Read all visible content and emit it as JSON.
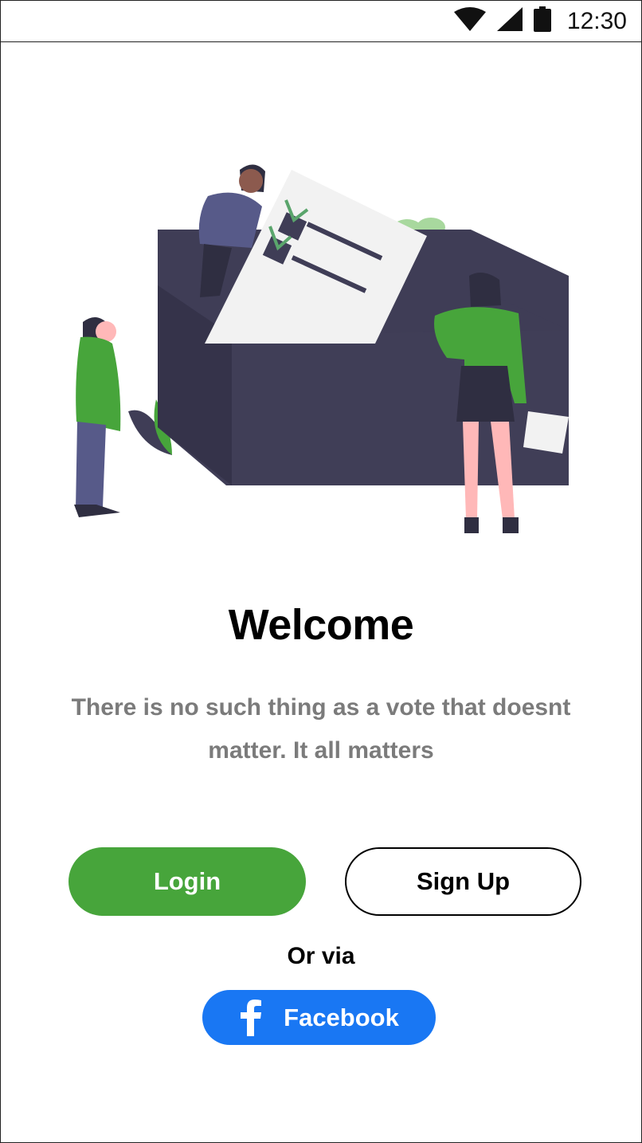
{
  "status_bar": {
    "time": "12:30",
    "icons": [
      "wifi-icon",
      "cellular-signal-icon",
      "battery-icon"
    ]
  },
  "illustration": {
    "name": "voting-illustration",
    "colors": {
      "ballot_box": "#3f3d56",
      "shirt_green": "#47a53b",
      "paper": "#f2f2f2",
      "check": "#5aa56c",
      "skin": "#ffb8b8",
      "jacket": "#575a89"
    }
  },
  "welcome": {
    "title": "Welcome",
    "subtitle": "There is no such thing as a vote that doesnt matter. It all matters"
  },
  "actions": {
    "login_label": "Login",
    "signup_label": "Sign Up",
    "or_via": "Or via",
    "facebook_label": "Facebook",
    "facebook_icon": "facebook-icon"
  },
  "colors": {
    "accent_green": "#47a53b",
    "facebook_blue": "#1977f3",
    "subtitle_gray": "#7b7b7b"
  }
}
